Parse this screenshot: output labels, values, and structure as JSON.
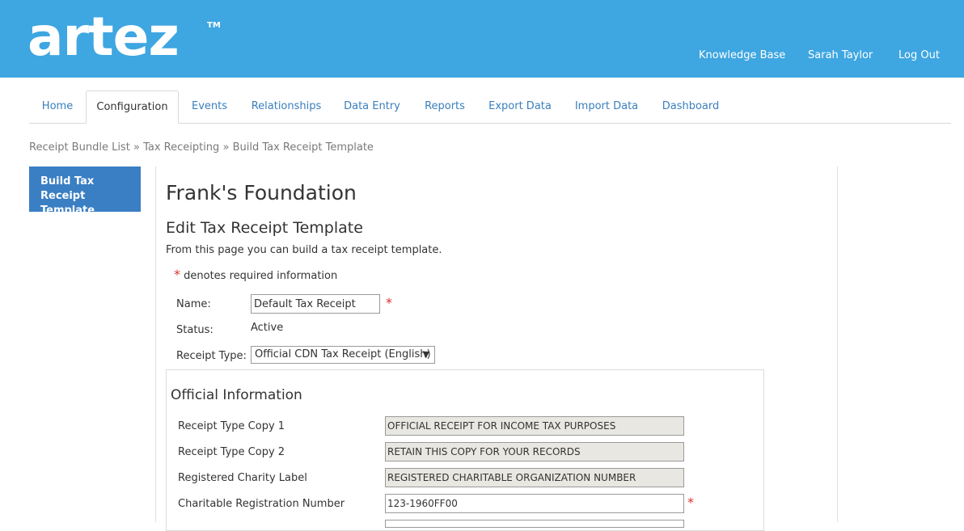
{
  "brand": {
    "logo_text": "artez",
    "trademark": "TM",
    "header_color": "#3ea6e1"
  },
  "top_links": {
    "knowledge_base": "Knowledge Base",
    "user_name": "Sarah Taylor",
    "logout": "Log Out"
  },
  "tabs": [
    {
      "label": "Home"
    },
    {
      "label": "Configuration",
      "active": true
    },
    {
      "label": "Events"
    },
    {
      "label": "Relationships"
    },
    {
      "label": "Data Entry"
    },
    {
      "label": "Reports"
    },
    {
      "label": "Export Data"
    },
    {
      "label": "Import Data"
    },
    {
      "label": "Dashboard"
    }
  ],
  "breadcrumb": {
    "items": [
      "Receipt Bundle List",
      "Tax Receipting",
      "Build Tax Receipt Template"
    ],
    "separator": "»"
  },
  "side_nav": {
    "active_item": "Build Tax Receipt Template"
  },
  "page": {
    "org_name": "Frank's Foundation",
    "heading": "Edit Tax Receipt Template",
    "intro": "From this page you can build a tax receipt template.",
    "required_star": "*",
    "required_note": "denotes required information"
  },
  "form": {
    "name_label": "Name:",
    "name_value": "Default Tax Receipt",
    "status_label": "Status:",
    "status_value": "Active",
    "receipt_type_label": "Receipt Type:",
    "receipt_type_value": "Official CDN Tax Receipt (English)",
    "dropdown_arrow": "▼"
  },
  "official_information": {
    "title": "Official Information",
    "fields": [
      {
        "label": "Receipt Type Copy 1",
        "value": "OFFICIAL RECEIPT FOR INCOME TAX PURPOSES",
        "readonly": true
      },
      {
        "label": "Receipt Type Copy 2",
        "value": "RETAIN THIS COPY FOR YOUR RECORDS",
        "readonly": true
      },
      {
        "label": "Registered Charity Label",
        "value": "REGISTERED CHARITABLE ORGANIZATION NUMBER",
        "readonly": true
      },
      {
        "label": "Charitable Registration Number",
        "value": "123-1960FF00",
        "readonly": false,
        "required": true
      }
    ]
  },
  "colors": {
    "accent": "#3a7fc4",
    "link": "#3a7fbd",
    "required": "#d9312b",
    "readonly_bg": "#e9e7e1"
  }
}
